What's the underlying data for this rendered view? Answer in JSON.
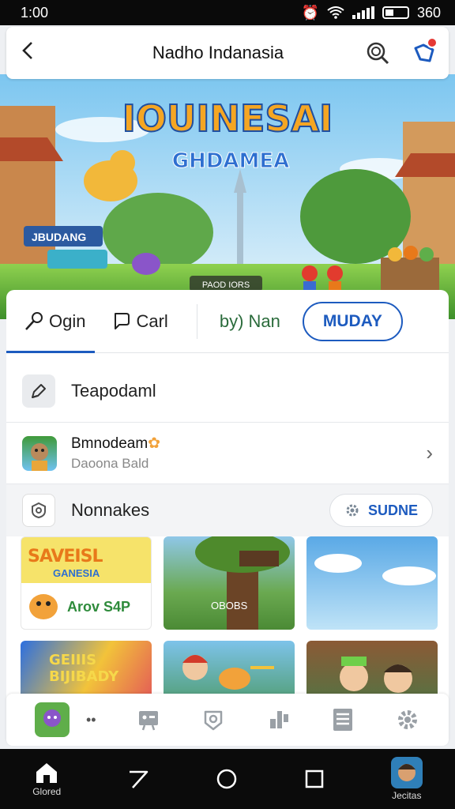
{
  "status": {
    "time": "1:00",
    "battery": "360"
  },
  "header": {
    "title": "Nadho Indanasia"
  },
  "banner": {
    "title": "IOUINESAI",
    "subtitle": "GHDAMEA",
    "sign": "JBUDANG",
    "button": "PAOD IORS"
  },
  "tabs": [
    {
      "label": "Ogin"
    },
    {
      "label": "Carl"
    },
    {
      "label": "by) Nan"
    }
  ],
  "tab_pill": "MUDAY",
  "rows": {
    "featured": {
      "label": "Teapodaml"
    },
    "app": {
      "title": "Bmnodeam",
      "subtitle": "Daoona Bald"
    }
  },
  "section": {
    "label": "Nonnakes",
    "button": "SUDNE"
  },
  "tiles": [
    {
      "title": "SAVEISL",
      "subtitle": "GANESIA",
      "caption": "Arov S4P"
    },
    {
      "caption": "OBOBS"
    },
    {
      "caption": ""
    },
    {
      "title": "GEIIIS BIJIBADY"
    },
    {
      "caption": ""
    },
    {
      "caption": ""
    }
  ],
  "sysnav": {
    "home_label": "Glored",
    "profile_label": "Jecitas"
  },
  "colors": {
    "accent": "#1d5bbf",
    "alert": "#e53935"
  }
}
